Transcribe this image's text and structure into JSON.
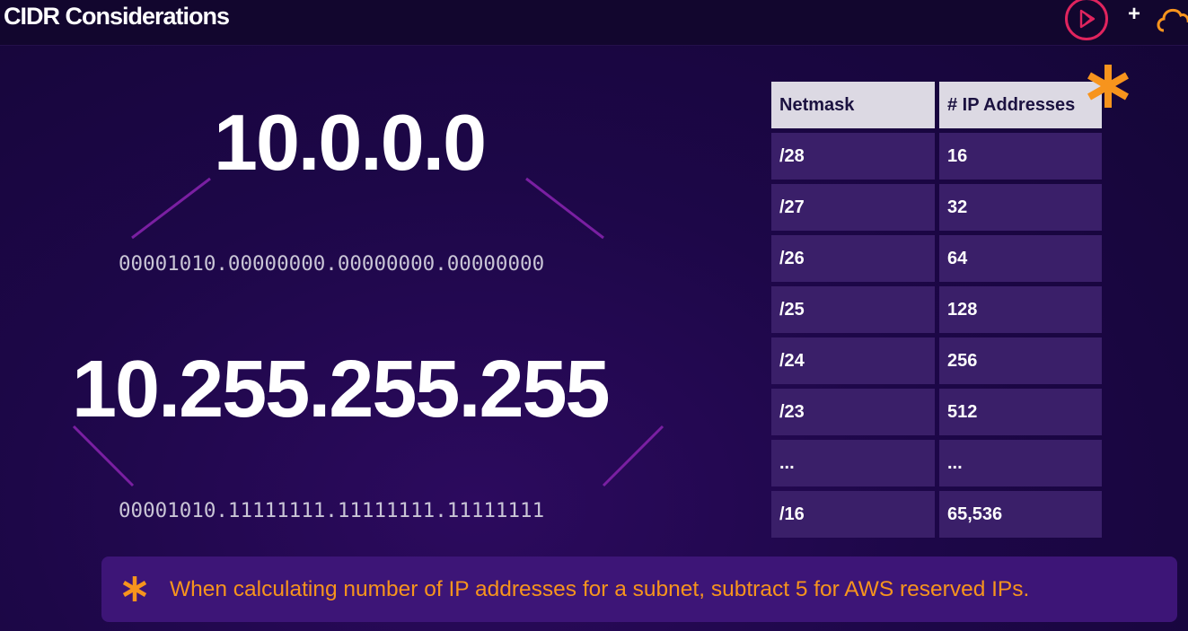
{
  "slide": {
    "title": "CIDR Considerations"
  },
  "toolbar": {
    "play_icon": "play-icon",
    "plus_label": "+",
    "cloud_icon": "cloud-icon"
  },
  "addresses": [
    {
      "ip": "10.0.0.0",
      "binary": "00001010.00000000.00000000.00000000"
    },
    {
      "ip": "10.255.255.255",
      "binary": "00001010.11111111.11111111.11111111"
    }
  ],
  "table": {
    "headers": [
      "Netmask",
      "# IP Addresses"
    ],
    "rows": [
      [
        "/28",
        "16"
      ],
      [
        "/27",
        "32"
      ],
      [
        "/26",
        "64"
      ],
      [
        "/25",
        "128"
      ],
      [
        "/24",
        "256"
      ],
      [
        "/23",
        "512"
      ],
      [
        "...",
        "..."
      ],
      [
        "/16",
        "65,536"
      ]
    ]
  },
  "note": {
    "icon": "asterisk-icon",
    "text": "When calculating number of IP addresses for a subnet, subtract 5 for AWS reserved IPs."
  },
  "colors": {
    "accent_orange": "#f7941d",
    "play_red": "#e0245e",
    "header_bg": "#dcd9e3",
    "cell_bg": "#3a1f69",
    "connector_purple": "#7a1fa2"
  }
}
